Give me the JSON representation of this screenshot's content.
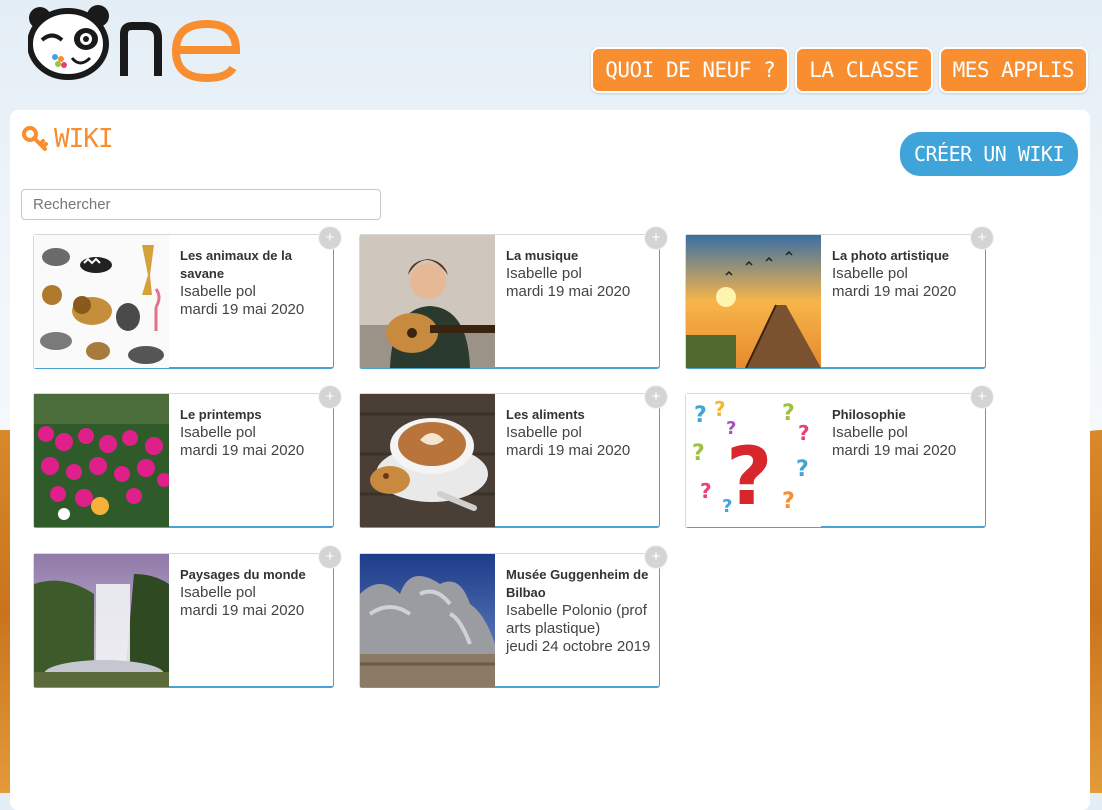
{
  "brand": {
    "logo_text": "ne"
  },
  "nav": {
    "items": [
      {
        "label": "QUOI DE NEUF ?"
      },
      {
        "label": "LA CLASSE"
      },
      {
        "label": "MES APPLIS"
      }
    ]
  },
  "page": {
    "title": "WIKI",
    "create_label": "CRÉER UN WIKI",
    "search_placeholder": "Rechercher"
  },
  "wikis": [
    {
      "title": "Les animaux de la savane",
      "author": "Isabelle pol",
      "date": "mardi 19 mai 2020",
      "thumb": "savanna-animals",
      "plus": "+"
    },
    {
      "title": "La musique",
      "author": "Isabelle pol",
      "date": "mardi 19 mai 2020",
      "thumb": "guitar-player",
      "plus": "+"
    },
    {
      "title": "La photo artistique",
      "author": "Isabelle pol",
      "date": "mardi 19 mai 2020",
      "thumb": "sunset-pier",
      "plus": "+"
    },
    {
      "title": "Le printemps",
      "author": "Isabelle pol",
      "date": "mardi 19 mai 2020",
      "thumb": "pink-flowers",
      "plus": "+"
    },
    {
      "title": "Les aliments",
      "author": "Isabelle pol",
      "date": "mardi 19 mai 2020",
      "thumb": "coffee-cup",
      "plus": "+"
    },
    {
      "title": "Philosophie",
      "author": "Isabelle pol",
      "date": "mardi 19 mai 2020",
      "thumb": "question-marks",
      "plus": "+"
    },
    {
      "title": "Paysages du monde",
      "author": "Isabelle pol",
      "date": "mardi 19 mai 2020",
      "thumb": "waterfall",
      "plus": "+"
    },
    {
      "title": "Musée Guggenheim de Bilbao",
      "author": "Isabelle Polonio (prof arts plastique)",
      "date": "jeudi 24 octobre 2019",
      "thumb": "guggenheim-museum",
      "plus": "+"
    }
  ],
  "colors": {
    "accent": "#f98e30",
    "primary_button": "#3ea4da",
    "card_border": "#4aa3d4"
  }
}
